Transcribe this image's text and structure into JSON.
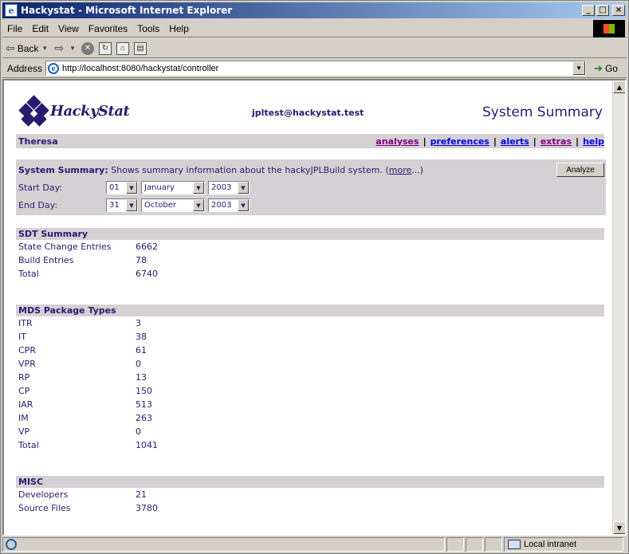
{
  "window": {
    "title": "Hackystat - Microsoft Internet Explorer"
  },
  "menu": [
    "File",
    "Edit",
    "View",
    "Favorites",
    "Tools",
    "Help"
  ],
  "toolbar": {
    "back_label": "Back"
  },
  "address": {
    "label": "Address",
    "url": "http://localhost:8080/hackystat/controller",
    "go_label": "Go"
  },
  "page": {
    "logo_text": "HackyStat",
    "user_email": "jpltest@hackystat.test",
    "heading": "System Summary",
    "user_name": "Theresa",
    "nav": [
      "analyses",
      "preferences",
      "alerts",
      "extras",
      "help"
    ],
    "desc_title": "System Summary:",
    "desc_text": " Shows summary information about the hackyJPLBuild system. (",
    "desc_more": "more",
    "desc_end": "...)",
    "analyze_label": "Analyze",
    "start": {
      "label": "Start Day:",
      "day": "01",
      "month": "January",
      "year": "2003"
    },
    "end": {
      "label": "End Day:",
      "day": "31",
      "month": "October",
      "year": "2003"
    },
    "sections": [
      {
        "title": "SDT Summary",
        "rows": [
          {
            "k": "State Change Entries",
            "v": "6662"
          },
          {
            "k": "Build Entries",
            "v": "78"
          },
          {
            "k": "Total",
            "v": "6740"
          }
        ]
      },
      {
        "title": "MDS Package Types",
        "rows": [
          {
            "k": "ITR",
            "v": "3"
          },
          {
            "k": "IT",
            "v": "38"
          },
          {
            "k": "CPR",
            "v": "61"
          },
          {
            "k": "VPR",
            "v": "0"
          },
          {
            "k": "RP",
            "v": "13"
          },
          {
            "k": "CP",
            "v": "150"
          },
          {
            "k": "IAR",
            "v": "513"
          },
          {
            "k": "IM",
            "v": "263"
          },
          {
            "k": "VP",
            "v": "0"
          },
          {
            "k": "Total",
            "v": "1041"
          }
        ]
      },
      {
        "title": "MISC",
        "rows": [
          {
            "k": "Developers",
            "v": "21"
          },
          {
            "k": "Source Files",
            "v": "3780"
          }
        ]
      }
    ]
  },
  "status": {
    "zone": "Local intranet"
  }
}
